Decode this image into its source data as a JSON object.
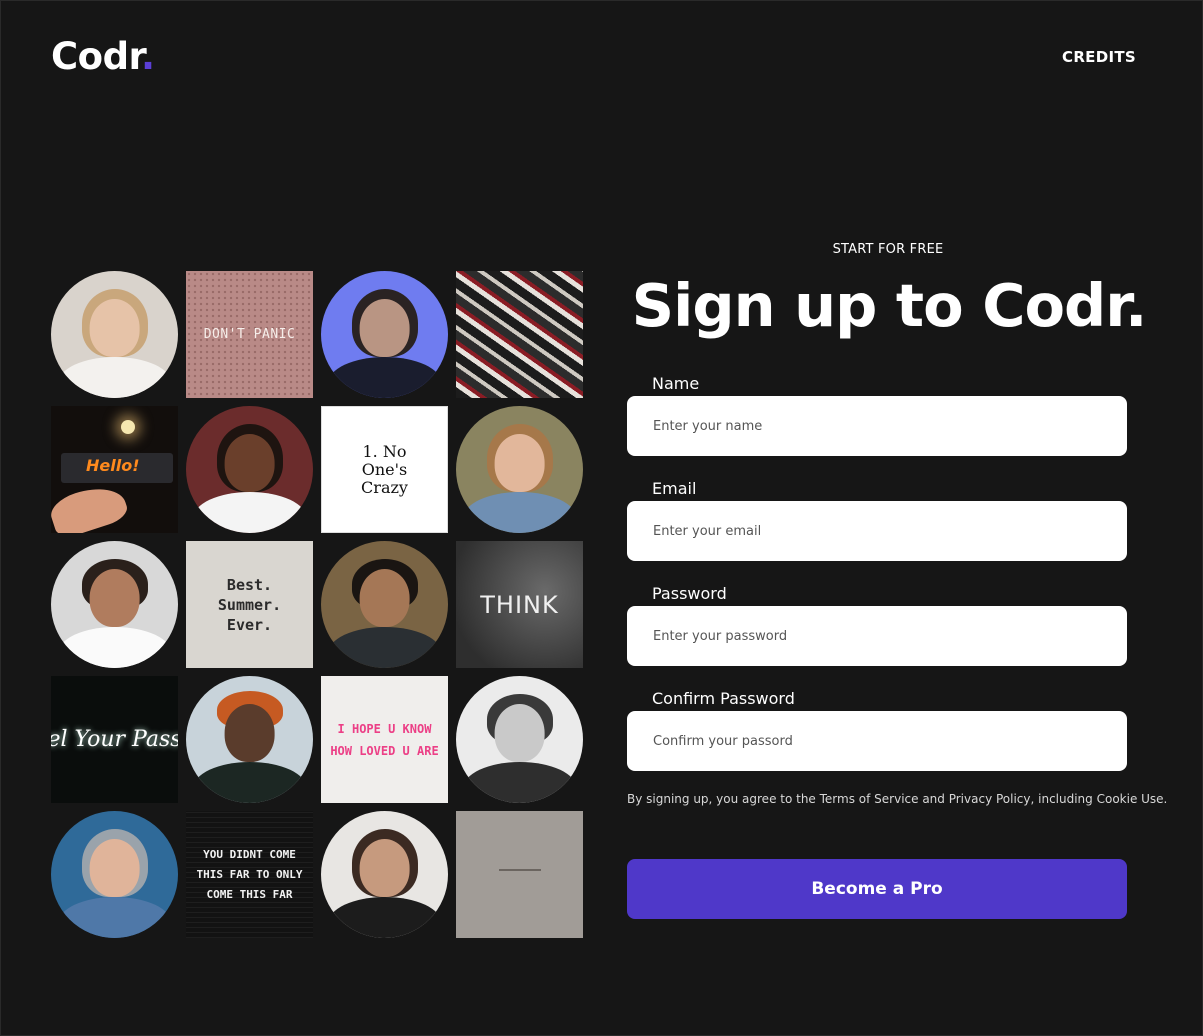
{
  "header": {
    "logo_text": "Codr",
    "logo_dot": ".",
    "nav_credits": "CREDITS"
  },
  "gallery": {
    "tiles": [
      {
        "kind": "portrait",
        "icon": "portrait-blonde-woman"
      },
      {
        "kind": "text",
        "text": "DON'T PANIC"
      },
      {
        "kind": "portrait",
        "icon": "portrait-woman-blue-light"
      },
      {
        "kind": "collage",
        "icon": "sticker-collage"
      },
      {
        "kind": "text",
        "text": "Hello!"
      },
      {
        "kind": "portrait",
        "icon": "portrait-woman-dark-bg"
      },
      {
        "kind": "text",
        "text": "1. No One's Crazy"
      },
      {
        "kind": "portrait",
        "icon": "portrait-woman-denim"
      },
      {
        "kind": "portrait",
        "icon": "portrait-man-smiling"
      },
      {
        "kind": "text",
        "text": "Best. Summer. Ever."
      },
      {
        "kind": "portrait",
        "icon": "portrait-man-outdoors"
      },
      {
        "kind": "text",
        "text": "THINK"
      },
      {
        "kind": "text",
        "text": "el Your Pass"
      },
      {
        "kind": "portrait",
        "icon": "portrait-man-orange-beanie"
      },
      {
        "kind": "text",
        "text": "I HOPE U KNOW HOW LOVED U ARE"
      },
      {
        "kind": "portrait",
        "icon": "portrait-man-bw"
      },
      {
        "kind": "portrait",
        "icon": "portrait-woman-hoodie"
      },
      {
        "kind": "text",
        "text": "YOU DIDNT COME THIS FAR TO ONLY COME THIS FAR"
      },
      {
        "kind": "portrait",
        "icon": "portrait-woman-black-top"
      },
      {
        "kind": "blank",
        "icon": "grey-tile"
      }
    ]
  },
  "form": {
    "eyebrow": "START FOR FREE",
    "headline": "Sign up to Codr.",
    "name_label": "Name",
    "name_placeholder": "Enter your name",
    "email_label": "Email",
    "email_placeholder": "Enter your email",
    "password_label": "Password",
    "password_placeholder": "Enter your password",
    "confirm_label": "Confirm Password",
    "confirm_placeholder": "Confirm your passord",
    "terms": "By signing up, you agree to the Terms of Service and Privacy Policy, including Cookie Use.",
    "cta": "Become a Pro"
  },
  "colors": {
    "background": "#161616",
    "accent": "#4f38c9",
    "logo_dot": "#5b3fd6"
  }
}
